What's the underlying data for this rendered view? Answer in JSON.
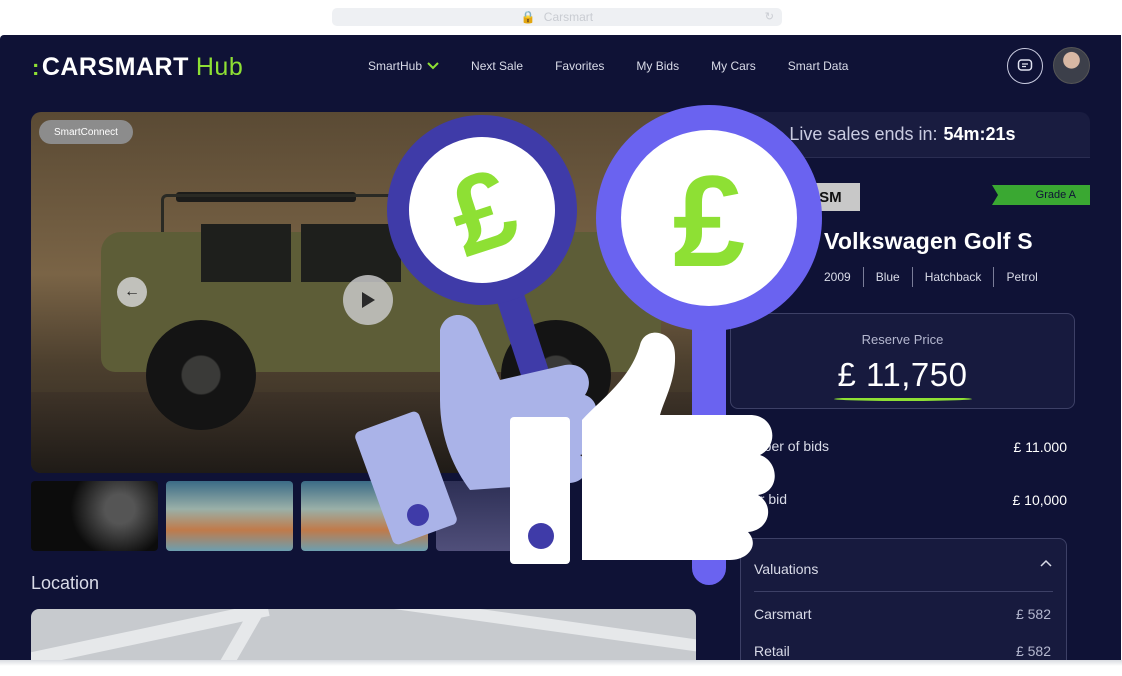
{
  "browser": {
    "address": "Carsmart"
  },
  "brand": {
    "logo_main": "CARSMART",
    "logo_hub": "Hub"
  },
  "nav": {
    "items": [
      {
        "label": "SmartHub"
      },
      {
        "label": "Next Sale"
      },
      {
        "label": "Favorites"
      },
      {
        "label": "My Bids"
      },
      {
        "label": "My Cars"
      },
      {
        "label": "Smart Data"
      }
    ]
  },
  "hero": {
    "tag": "SmartConnect"
  },
  "location": {
    "title": "Location"
  },
  "live": {
    "prefix": "Live sales ends in:",
    "timer": "54m:21s"
  },
  "car": {
    "badge": "CSM",
    "grade": "Grade A",
    "title": "Volkswagen Golf S",
    "specs": [
      "2009",
      "Blue",
      "Hatchback",
      "Petrol"
    ]
  },
  "reserve": {
    "label": "Reserve Price",
    "price": "£ 11,750"
  },
  "bids": {
    "number_label": "mber of bids",
    "number_value": "£ 11.000",
    "your_label": "ur bid",
    "your_value": "£ 10,000"
  },
  "valuations": {
    "title": "Valuations",
    "rows": [
      {
        "label": "Carsmart",
        "value": "£ 582"
      },
      {
        "label": "Retail",
        "value": "£ 582"
      }
    ]
  },
  "colors": {
    "accent": "#8ee034",
    "background": "#0f1236",
    "paddle_dark": "#3f3ba8",
    "paddle_light": "#6a63f0"
  }
}
